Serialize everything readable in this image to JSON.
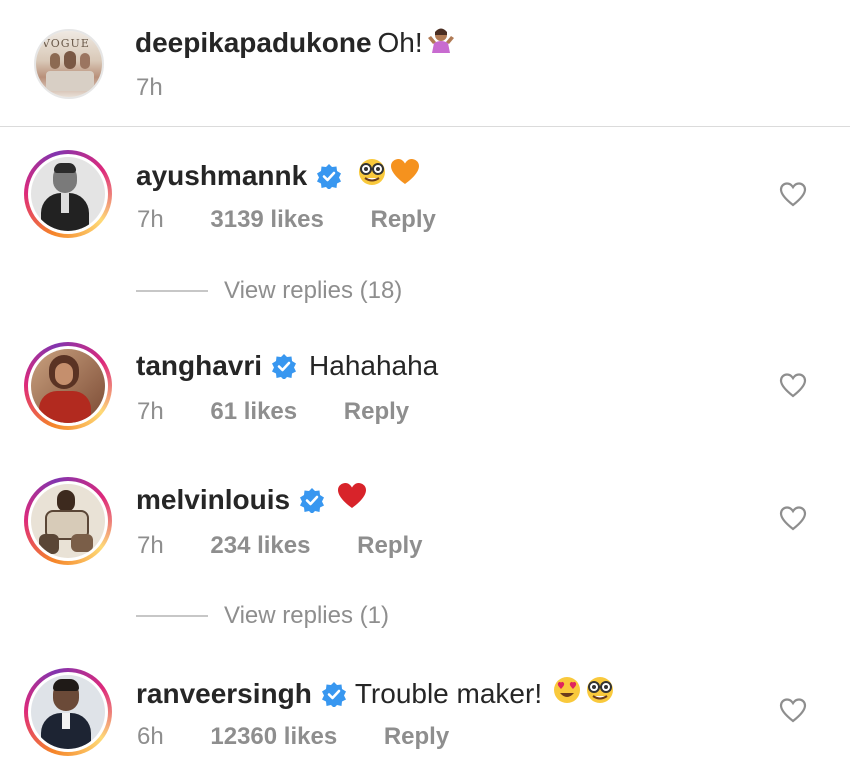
{
  "caption": {
    "username": "deepikapadukone",
    "text": "Oh!",
    "time": "7h",
    "avatar_text": "VOGUE"
  },
  "comments": [
    {
      "username": "ayushmannk",
      "verified": true,
      "text": "",
      "emojis": [
        "nerd-face-emoji",
        "orange-heart-emoji"
      ],
      "time": "7h",
      "likes": "3139 likes",
      "reply": "Reply",
      "view_replies": "View replies (18)"
    },
    {
      "username": "tanghavri",
      "verified": true,
      "text": "Hahahaha",
      "emojis": [],
      "time": "7h",
      "likes": "61 likes",
      "reply": "Reply"
    },
    {
      "username": "melvinlouis",
      "verified": true,
      "text": "",
      "emojis": [
        "red-heart-emoji"
      ],
      "time": "7h",
      "likes": "234 likes",
      "reply": "Reply",
      "view_replies": "View replies (1)"
    },
    {
      "username": "ranveersingh",
      "verified": true,
      "text": "Trouble maker!",
      "emojis": [
        "heart-eyes-emoji",
        "nerd-face-emoji"
      ],
      "time": "6h",
      "likes": "12360 likes",
      "reply": "Reply"
    }
  ],
  "colors": {
    "verified_blue": "#3897f0",
    "meta_gray": "#8e8e8e",
    "text": "#262626"
  }
}
